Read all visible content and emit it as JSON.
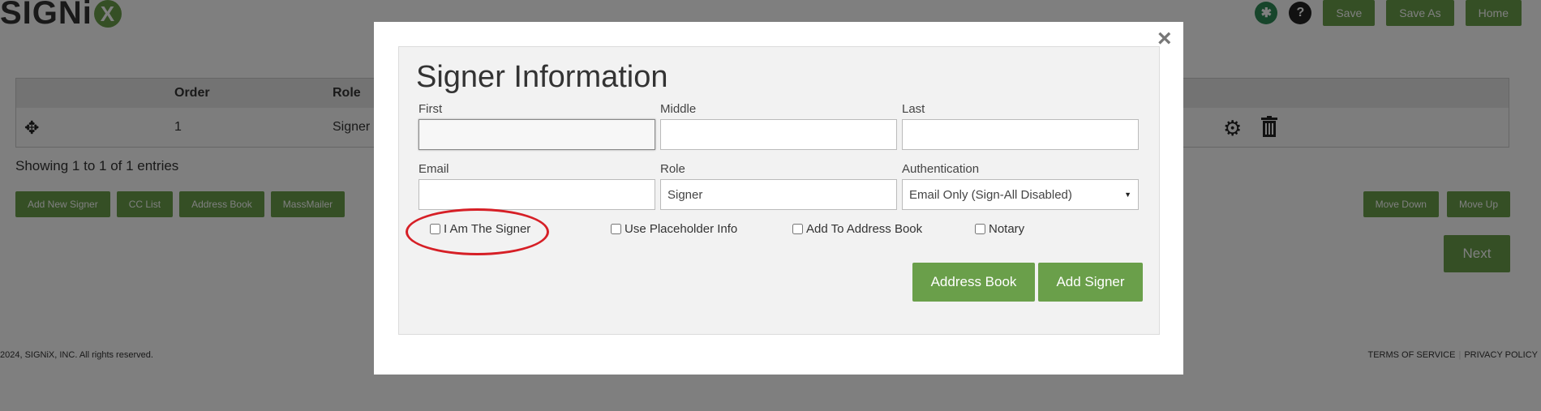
{
  "app": {
    "logo_text": "SIGNi",
    "logo_x": "X",
    "top_buttons": {
      "save": "Save",
      "save_as": "Save As",
      "home": "Home"
    },
    "help_glyph": "?"
  },
  "table": {
    "headers": {
      "order": "Order",
      "role": "Role"
    },
    "row": {
      "order": "1",
      "role": "Signer"
    }
  },
  "showing_text": "Showing 1 to 1 of 1 entries",
  "left_buttons": [
    "Add New Signer",
    "CC List",
    "Address Book",
    "MassMailer"
  ],
  "right_buttons": {
    "move_down": "Move Down",
    "move_up": "Move Up"
  },
  "next_label": "Next",
  "footer": {
    "copyright": "2024, SIGNiX, INC. All rights reserved.",
    "terms": "TERMS OF SERVICE",
    "privacy": "PRIVACY POLICY"
  },
  "modal": {
    "close_glyph": "×",
    "title": "Signer Information",
    "first_label": "First",
    "first_value": "",
    "middle_label": "Middle",
    "middle_value": "",
    "last_label": "Last",
    "last_value": "",
    "email_label": "Email",
    "email_value": "",
    "role_label": "Role",
    "role_value": "Signer",
    "auth_label": "Authentication",
    "auth_value": "Email Only (Sign-All Disabled)",
    "checkboxes": {
      "i_am_signer": "I Am The Signer",
      "placeholder": "Use Placeholder Info",
      "address_book": "Add To Address Book",
      "notary": "Notary"
    },
    "address_book_button": "Address Book",
    "add_signer_button": "Add Signer"
  },
  "colors": {
    "brand_green": "#6a9f4a",
    "highlight_red": "#d61f26"
  }
}
